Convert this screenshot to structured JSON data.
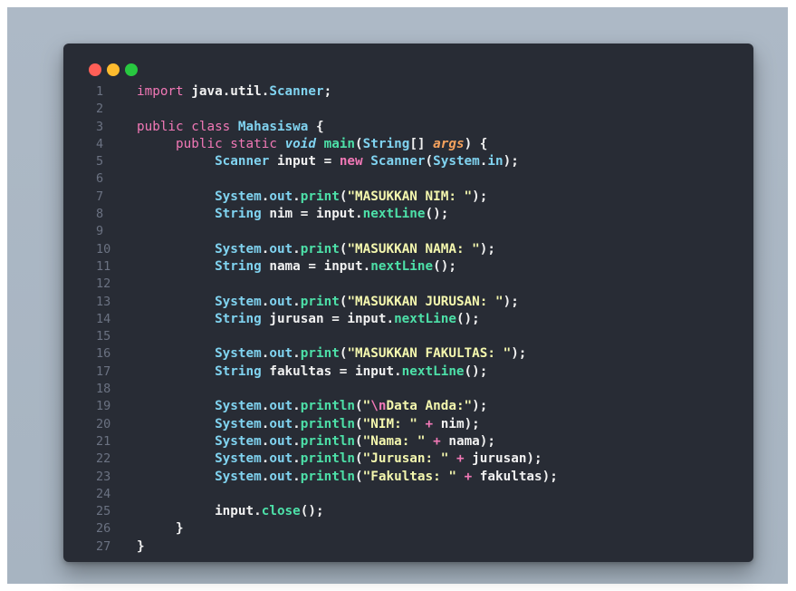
{
  "window": {
    "dots": [
      {
        "name": "close-dot",
        "color": "#ff5f57"
      },
      {
        "name": "minimize-dot",
        "color": "#febc2e"
      },
      {
        "name": "maximize-dot",
        "color": "#28c840"
      }
    ]
  },
  "colors": {
    "keyword": "#f178b6",
    "type": "#80d3f0",
    "method": "#4de0a8",
    "string": "#f4f7ae",
    "plain": "#f1f1f1",
    "escape": "#f178b6",
    "param": "#f5a25d",
    "line_number": "#6b7282",
    "background": "#282c35"
  },
  "code": {
    "lines": [
      {
        "n": "1",
        "tokens": [
          [
            "kw",
            "import "
          ],
          [
            "pl",
            "java.util."
          ],
          [
            "ty",
            "Scanner"
          ],
          [
            "pl",
            ";"
          ]
        ]
      },
      {
        "n": "2",
        "tokens": []
      },
      {
        "n": "3",
        "tokens": [
          [
            "kw",
            "public class "
          ],
          [
            "ty",
            "Mahasiswa"
          ],
          [
            "pl",
            " {"
          ]
        ]
      },
      {
        "n": "4",
        "tokens": [
          [
            "pl",
            "     "
          ],
          [
            "kw",
            "public static "
          ],
          [
            "kwi",
            "void"
          ],
          [
            "pl",
            " "
          ],
          [
            "me",
            "main"
          ],
          [
            "pl",
            "("
          ],
          [
            "ty",
            "String"
          ],
          [
            "pl",
            "[] "
          ],
          [
            "pa",
            "args"
          ],
          [
            "pl",
            ") {"
          ]
        ]
      },
      {
        "n": "5",
        "tokens": [
          [
            "pl",
            "          "
          ],
          [
            "ty",
            "Scanner"
          ],
          [
            "pl",
            " input = "
          ],
          [
            "kwb",
            "new "
          ],
          [
            "ty",
            "Scanner"
          ],
          [
            "pl",
            "("
          ],
          [
            "ty",
            "System"
          ],
          [
            "pl",
            "."
          ],
          [
            "ty",
            "in"
          ],
          [
            "pl",
            ");"
          ]
        ]
      },
      {
        "n": "6",
        "tokens": []
      },
      {
        "n": "7",
        "tokens": [
          [
            "pl",
            "          "
          ],
          [
            "ty",
            "System"
          ],
          [
            "pl",
            "."
          ],
          [
            "ty",
            "out"
          ],
          [
            "pl",
            "."
          ],
          [
            "me",
            "print"
          ],
          [
            "pl",
            "("
          ],
          [
            "st",
            "\"MASUKKAN NIM: \""
          ],
          [
            "pl",
            ");"
          ]
        ]
      },
      {
        "n": "8",
        "tokens": [
          [
            "pl",
            "          "
          ],
          [
            "ty",
            "String"
          ],
          [
            "pl",
            " nim = input."
          ],
          [
            "me",
            "nextLine"
          ],
          [
            "pl",
            "();"
          ]
        ]
      },
      {
        "n": "9",
        "tokens": []
      },
      {
        "n": "10",
        "tokens": [
          [
            "pl",
            "          "
          ],
          [
            "ty",
            "System"
          ],
          [
            "pl",
            "."
          ],
          [
            "ty",
            "out"
          ],
          [
            "pl",
            "."
          ],
          [
            "me",
            "print"
          ],
          [
            "pl",
            "("
          ],
          [
            "st",
            "\"MASUKKAN NAMA: \""
          ],
          [
            "pl",
            ");"
          ]
        ]
      },
      {
        "n": "11",
        "tokens": [
          [
            "pl",
            "          "
          ],
          [
            "ty",
            "String"
          ],
          [
            "pl",
            " nama = input."
          ],
          [
            "me",
            "nextLine"
          ],
          [
            "pl",
            "();"
          ]
        ]
      },
      {
        "n": "12",
        "tokens": []
      },
      {
        "n": "13",
        "tokens": [
          [
            "pl",
            "          "
          ],
          [
            "ty",
            "System"
          ],
          [
            "pl",
            "."
          ],
          [
            "ty",
            "out"
          ],
          [
            "pl",
            "."
          ],
          [
            "me",
            "print"
          ],
          [
            "pl",
            "("
          ],
          [
            "st",
            "\"MASUKKAN JURUSAN: \""
          ],
          [
            "pl",
            ");"
          ]
        ]
      },
      {
        "n": "14",
        "tokens": [
          [
            "pl",
            "          "
          ],
          [
            "ty",
            "String"
          ],
          [
            "pl",
            " jurusan = input."
          ],
          [
            "me",
            "nextLine"
          ],
          [
            "pl",
            "();"
          ]
        ]
      },
      {
        "n": "15",
        "tokens": []
      },
      {
        "n": "16",
        "tokens": [
          [
            "pl",
            "          "
          ],
          [
            "ty",
            "System"
          ],
          [
            "pl",
            "."
          ],
          [
            "ty",
            "out"
          ],
          [
            "pl",
            "."
          ],
          [
            "me",
            "print"
          ],
          [
            "pl",
            "("
          ],
          [
            "st",
            "\"MASUKKAN FAKULTAS: \""
          ],
          [
            "pl",
            ");"
          ]
        ]
      },
      {
        "n": "17",
        "tokens": [
          [
            "pl",
            "          "
          ],
          [
            "ty",
            "String"
          ],
          [
            "pl",
            " fakultas = input."
          ],
          [
            "me",
            "nextLine"
          ],
          [
            "pl",
            "();"
          ]
        ]
      },
      {
        "n": "18",
        "tokens": []
      },
      {
        "n": "19",
        "tokens": [
          [
            "pl",
            "          "
          ],
          [
            "ty",
            "System"
          ],
          [
            "pl",
            "."
          ],
          [
            "ty",
            "out"
          ],
          [
            "pl",
            "."
          ],
          [
            "me",
            "println"
          ],
          [
            "pl",
            "("
          ],
          [
            "st",
            "\""
          ],
          [
            "es",
            "\\n"
          ],
          [
            "st",
            "Data Anda:\""
          ],
          [
            "pl",
            ");"
          ]
        ]
      },
      {
        "n": "20",
        "tokens": [
          [
            "pl",
            "          "
          ],
          [
            "ty",
            "System"
          ],
          [
            "pl",
            "."
          ],
          [
            "ty",
            "out"
          ],
          [
            "pl",
            "."
          ],
          [
            "me",
            "println"
          ],
          [
            "pl",
            "("
          ],
          [
            "st",
            "\"NIM: \""
          ],
          [
            "pl",
            " "
          ],
          [
            "kw",
            "+"
          ],
          [
            "pl",
            " nim);"
          ]
        ]
      },
      {
        "n": "21",
        "tokens": [
          [
            "pl",
            "          "
          ],
          [
            "ty",
            "System"
          ],
          [
            "pl",
            "."
          ],
          [
            "ty",
            "out"
          ],
          [
            "pl",
            "."
          ],
          [
            "me",
            "println"
          ],
          [
            "pl",
            "("
          ],
          [
            "st",
            "\"Nama: \""
          ],
          [
            "pl",
            " "
          ],
          [
            "kw",
            "+"
          ],
          [
            "pl",
            " nama);"
          ]
        ]
      },
      {
        "n": "22",
        "tokens": [
          [
            "pl",
            "          "
          ],
          [
            "ty",
            "System"
          ],
          [
            "pl",
            "."
          ],
          [
            "ty",
            "out"
          ],
          [
            "pl",
            "."
          ],
          [
            "me",
            "println"
          ],
          [
            "pl",
            "("
          ],
          [
            "st",
            "\"Jurusan: \""
          ],
          [
            "pl",
            " "
          ],
          [
            "kw",
            "+"
          ],
          [
            "pl",
            " jurusan);"
          ]
        ]
      },
      {
        "n": "23",
        "tokens": [
          [
            "pl",
            "          "
          ],
          [
            "ty",
            "System"
          ],
          [
            "pl",
            "."
          ],
          [
            "ty",
            "out"
          ],
          [
            "pl",
            "."
          ],
          [
            "me",
            "println"
          ],
          [
            "pl",
            "("
          ],
          [
            "st",
            "\"Fakultas: \""
          ],
          [
            "pl",
            " "
          ],
          [
            "kw",
            "+"
          ],
          [
            "pl",
            " fakultas);"
          ]
        ]
      },
      {
        "n": "24",
        "tokens": []
      },
      {
        "n": "25",
        "tokens": [
          [
            "pl",
            "          input."
          ],
          [
            "me",
            "close"
          ],
          [
            "pl",
            "();"
          ]
        ]
      },
      {
        "n": "26",
        "tokens": [
          [
            "pl",
            "     }"
          ]
        ]
      },
      {
        "n": "27",
        "tokens": [
          [
            "pl",
            "}"
          ]
        ]
      }
    ]
  }
}
